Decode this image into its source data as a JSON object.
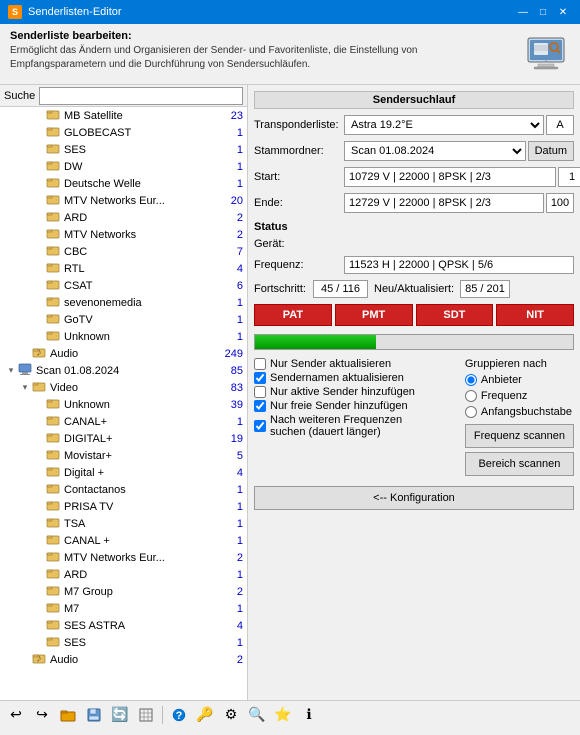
{
  "titlebar": {
    "title": "Senderlisten-Editor",
    "min_btn": "—",
    "max_btn": "□",
    "close_btn": "✕"
  },
  "header": {
    "title": "Senderliste bearbeiten:",
    "description": "Ermöglicht das Ändern und Organisieren der Sender- und Favoritenliste, die Einstellung von\nEmpfangsparametern und die Durchführung von Sendersuchläufen."
  },
  "search": {
    "label": "Suche",
    "placeholder": ""
  },
  "tree": {
    "items": [
      {
        "label": "MB Satellite",
        "count": "23",
        "indent": 2,
        "type": "folder",
        "toggle": "leaf"
      },
      {
        "label": "GLOBECAST",
        "count": "1",
        "indent": 2,
        "type": "folder",
        "toggle": "leaf"
      },
      {
        "label": "SES",
        "count": "1",
        "indent": 2,
        "type": "folder",
        "toggle": "leaf"
      },
      {
        "label": "DW",
        "count": "1",
        "indent": 2,
        "type": "folder",
        "toggle": "leaf"
      },
      {
        "label": "Deutsche Welle",
        "count": "1",
        "indent": 2,
        "type": "folder",
        "toggle": "leaf"
      },
      {
        "label": "MTV Networks Eur...",
        "count": "20",
        "indent": 2,
        "type": "folder",
        "toggle": "leaf"
      },
      {
        "label": "ARD",
        "count": "2",
        "indent": 2,
        "type": "folder",
        "toggle": "leaf"
      },
      {
        "label": "MTV Networks",
        "count": "2",
        "indent": 2,
        "type": "folder",
        "toggle": "leaf"
      },
      {
        "label": "CBC",
        "count": "7",
        "indent": 2,
        "type": "folder",
        "toggle": "leaf"
      },
      {
        "label": "RTL",
        "count": "4",
        "indent": 2,
        "type": "folder",
        "toggle": "leaf"
      },
      {
        "label": "CSAT",
        "count": "6",
        "indent": 2,
        "type": "folder",
        "toggle": "leaf"
      },
      {
        "label": "sevenonemedia",
        "count": "1",
        "indent": 2,
        "type": "folder",
        "toggle": "leaf"
      },
      {
        "label": "GoTV",
        "count": "1",
        "indent": 2,
        "type": "folder",
        "toggle": "leaf"
      },
      {
        "label": "Unknown",
        "count": "1",
        "indent": 2,
        "type": "folder",
        "toggle": "leaf"
      },
      {
        "label": "Audio",
        "count": "249",
        "indent": 1,
        "type": "folder",
        "toggle": "leaf"
      },
      {
        "label": "Scan 01.08.2024",
        "count": "85",
        "indent": 0,
        "type": "root",
        "toggle": "open"
      },
      {
        "label": "Video",
        "count": "83",
        "indent": 1,
        "type": "folder",
        "toggle": "open"
      },
      {
        "label": "Unknown",
        "count": "39",
        "indent": 2,
        "type": "folder",
        "toggle": "leaf"
      },
      {
        "label": "CANAL+",
        "count": "1",
        "indent": 2,
        "type": "folder",
        "toggle": "leaf"
      },
      {
        "label": "DIGITAL+",
        "count": "19",
        "indent": 2,
        "type": "folder",
        "toggle": "leaf"
      },
      {
        "label": "Movistar+",
        "count": "5",
        "indent": 2,
        "type": "folder",
        "toggle": "leaf"
      },
      {
        "label": "Digital +",
        "count": "4",
        "indent": 2,
        "type": "folder",
        "toggle": "leaf"
      },
      {
        "label": "Contactanos",
        "count": "1",
        "indent": 2,
        "type": "folder",
        "toggle": "leaf"
      },
      {
        "label": "PRISA TV",
        "count": "1",
        "indent": 2,
        "type": "folder",
        "toggle": "leaf"
      },
      {
        "label": "TSA",
        "count": "1",
        "indent": 2,
        "type": "folder",
        "toggle": "leaf"
      },
      {
        "label": "CANAL +",
        "count": "1",
        "indent": 2,
        "type": "folder",
        "toggle": "leaf"
      },
      {
        "label": "MTV Networks Eur...",
        "count": "2",
        "indent": 2,
        "type": "folder",
        "toggle": "leaf"
      },
      {
        "label": "ARD",
        "count": "1",
        "indent": 2,
        "type": "folder",
        "toggle": "leaf"
      },
      {
        "label": "M7 Group",
        "count": "2",
        "indent": 2,
        "type": "folder",
        "toggle": "leaf"
      },
      {
        "label": "M7",
        "count": "1",
        "indent": 2,
        "type": "folder",
        "toggle": "leaf"
      },
      {
        "label": "SES ASTRA",
        "count": "4",
        "indent": 2,
        "type": "folder",
        "toggle": "leaf"
      },
      {
        "label": "SES",
        "count": "1",
        "indent": 2,
        "type": "folder",
        "toggle": "leaf"
      },
      {
        "label": "Audio",
        "count": "2",
        "indent": 1,
        "type": "folder",
        "toggle": "leaf"
      }
    ]
  },
  "right": {
    "section_title": "Sendersuchlauf",
    "transponder_label": "Transponderliste:",
    "transponder_value": "Astra 19.2°E",
    "transponder_suffix": "A",
    "stammordner_label": "Stammordner:",
    "stammordner_value": "Scan 01.08.2024",
    "stammordner_btn": "Datum",
    "start_label": "Start:",
    "start_value": "10729 V | 22000 | 8PSK | 2/3",
    "start_spin": "1",
    "ende_label": "Ende:",
    "ende_value": "12729 V | 22000 | 8PSK | 2/3",
    "ende_spin": "100",
    "status_title": "Status",
    "geraet_label": "Gerät:",
    "geraet_value": "",
    "frequenz_label": "Frequenz:",
    "frequenz_value": "11523 H | 22000 | QPSK | 5/6",
    "fortschritt_label": "Fortschritt:",
    "fortschritt_value": "45 / 116",
    "neu_label": "Neu/Aktualisiert:",
    "neu_value": "85 / 201",
    "btn_pat": "PAT",
    "btn_pmt": "PMT",
    "btn_sdt": "SDT",
    "btn_nit": "NIT",
    "progress_pct": 38,
    "cb_nur_sender": {
      "label": "Nur Sender aktualisieren",
      "checked": false
    },
    "cb_sendernamen": {
      "label": "Sendernamen aktualisieren",
      "checked": true
    },
    "cb_nur_aktive": {
      "label": "Nur aktive Sender hinzufügen",
      "checked": false
    },
    "cb_nur_freie": {
      "label": "Nur freie Sender hinzufügen",
      "checked": true
    },
    "cb_weitere": {
      "label": "Nach weiteren Frequenzen suchen (dauert länger)",
      "checked": true
    },
    "group_title": "Gruppieren nach",
    "radio_anbieter": {
      "label": "Anbieter",
      "checked": true
    },
    "radio_frequenz": {
      "label": "Frequenz",
      "checked": false
    },
    "radio_anfang": {
      "label": "Anfangsbuchstabe",
      "checked": false
    },
    "btn_frequenz": "Frequenz scannen",
    "btn_bereich": "Bereich scannen",
    "btn_konfiguration": "<-- Konfiguration"
  },
  "toolbar": {
    "buttons": [
      {
        "name": "undo-icon",
        "glyph": "↩",
        "tip": "Rückgängig"
      },
      {
        "name": "redo-icon",
        "glyph": "↪",
        "tip": "Wiederholen"
      },
      {
        "name": "open-icon",
        "glyph": "📂",
        "tip": "Öffnen"
      },
      {
        "name": "save-icon",
        "glyph": "💾",
        "tip": "Speichern"
      },
      {
        "name": "refresh-icon",
        "glyph": "🔄",
        "tip": "Aktualisieren"
      },
      {
        "name": "table-icon",
        "glyph": "⊞",
        "tip": "Tabelle"
      },
      {
        "name": "sep1",
        "glyph": "",
        "tip": ""
      },
      {
        "name": "help-icon",
        "glyph": "❓",
        "tip": "Hilfe"
      },
      {
        "name": "key-icon",
        "glyph": "🔑",
        "tip": "Lizenz"
      },
      {
        "name": "settings-icon",
        "glyph": "⚙",
        "tip": "Einstellungen"
      },
      {
        "name": "search2-icon",
        "glyph": "🔍",
        "tip": "Suche"
      },
      {
        "name": "star-icon",
        "glyph": "⭐",
        "tip": "Favoriten"
      },
      {
        "name": "info-icon",
        "glyph": "ℹ",
        "tip": "Info"
      }
    ]
  }
}
